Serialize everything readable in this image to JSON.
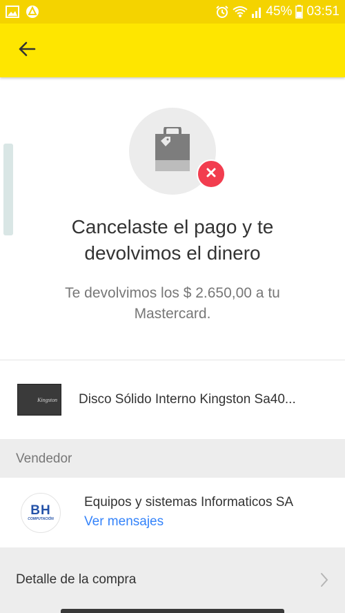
{
  "status_bar": {
    "battery": "45%",
    "time": "03:51",
    "left_icons": [
      "image-icon",
      "warning-icon"
    ],
    "right_icons": [
      "alarm-icon",
      "wifi-icon",
      "signal-icon",
      "battery-icon"
    ]
  },
  "app_bar": {
    "back_icon": "arrow-left-icon",
    "color": "#fee600"
  },
  "hero": {
    "icon": "shopping-bag-icon",
    "badge_icon": "close-icon",
    "badge_color": "#f23d4f",
    "title": "Cancelaste el pago y te devolvimos el dinero",
    "subtitle": "Te devolvimos los $ 2.650,00 a tu Mastercard."
  },
  "product": {
    "thumbnail_brand": "Kingston",
    "name": "Disco Sólido Interno Kingston Sa40..."
  },
  "seller_section": {
    "header": "Vendedor",
    "avatar_text": "BH",
    "avatar_subtext": "COMPUTACIÓN",
    "name": "Equipos y sistemas Informaticos SA",
    "link": "Ver mensajes",
    "link_color": "#3483fa"
  },
  "detail": {
    "label": "Detalle de la compra",
    "chevron_icon": "chevron-right-icon"
  }
}
